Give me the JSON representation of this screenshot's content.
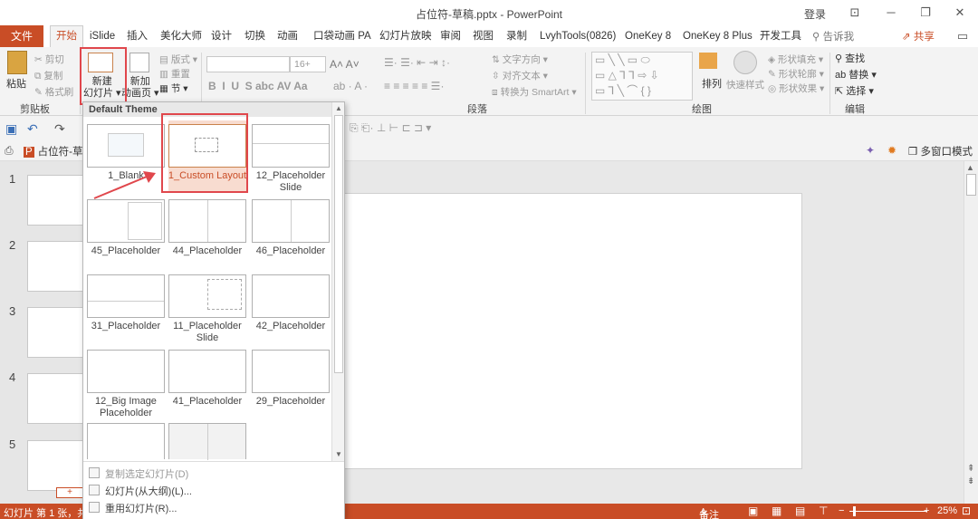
{
  "window": {
    "title": "占位符-草稿.pptx  -  PowerPoint",
    "login": "登录"
  },
  "menu": {
    "file": "文件",
    "tabs": [
      "开始",
      "iSlide",
      "插入",
      "美化大师",
      "设计",
      "切换",
      "动画",
      "口袋动画 PA",
      "幻灯片放映",
      "审阅",
      "视图",
      "录制",
      "LvyhTools(0826)",
      "OneKey 8",
      "OneKey 8 Plus",
      "开发工具"
    ],
    "tell_me": "告诉我",
    "share": "共享"
  },
  "ribbon": {
    "paste": "粘贴",
    "cut": "剪切",
    "copy": "复制",
    "format_painter": "格式刷",
    "clipboard_group": "剪贴板",
    "new_slide": "新建\n幻灯片",
    "new_slide_line1": "新建",
    "new_slide_line2": "幻灯片 ▾",
    "add_anim_line1": "新加",
    "add_anim_line2": "动画页 ▾",
    "layout": "版式 ▾",
    "reset": "重置",
    "section": "节 ▾",
    "font_size": "16+",
    "paragraph_group": "段落",
    "text_direction": "文字方向 ▾",
    "align_text": "对齐文本 ▾",
    "convert_smartart": "转换为 SmartArt ▾",
    "arrange": "排列",
    "quick_style": "快速样式",
    "shape_fill": "形状填充 ▾",
    "shape_outline": "形状轮廓 ▾",
    "shape_effect": "形状效果 ▾",
    "drawing_group": "绘图",
    "find": "查找",
    "replace": "替换 ▾",
    "select": "选择 ▾",
    "editing_group": "编辑"
  },
  "docbar": {
    "doc_tab": "占位符-草",
    "multi_window": "多窗口模式"
  },
  "slides": {
    "numbers": [
      "1",
      "2",
      "3",
      "4",
      "5"
    ]
  },
  "gallery": {
    "header": "Default Theme",
    "layouts": [
      {
        "name": "1_Blank"
      },
      {
        "name": "1_Custom Layout"
      },
      {
        "name": "12_Placeholder Slide"
      },
      {
        "name": "45_Placeholder"
      },
      {
        "name": "44_Placeholder"
      },
      {
        "name": "46_Placeholder"
      },
      {
        "name": "31_Placeholder"
      },
      {
        "name": "11_Placeholder Slide"
      },
      {
        "name": "42_Placeholder"
      },
      {
        "name": "12_Big Image Placeholder"
      },
      {
        "name": "41_Placeholder"
      },
      {
        "name": "29_Placeholder"
      }
    ],
    "menu": {
      "duplicate": "复制选定幻灯片(D)",
      "from_outline": "幻灯片(从大纲)(L)...",
      "reuse": "重用幻灯片(R)..."
    }
  },
  "status": {
    "slide_info": "幻灯片 第 1 张，共",
    "notes": "备注",
    "zoom": "25%"
  },
  "colors": {
    "accent": "#c94d26",
    "highlight": "#e0474c"
  }
}
